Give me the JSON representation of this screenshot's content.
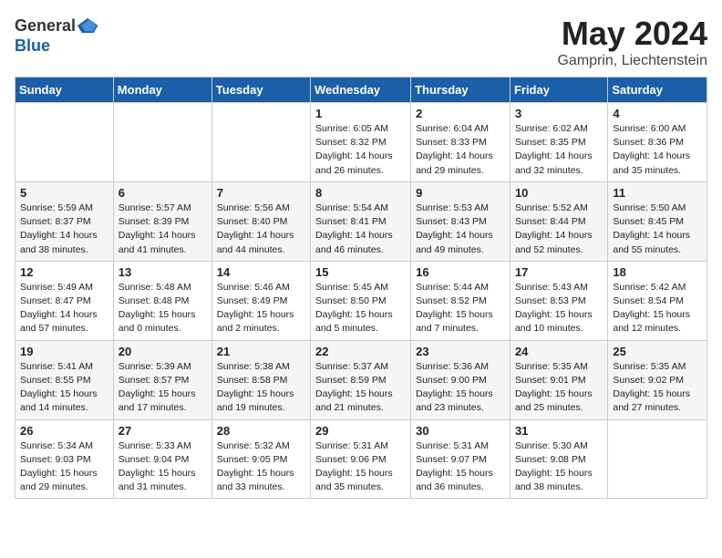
{
  "logo": {
    "general": "General",
    "blue": "Blue"
  },
  "title": "May 2024",
  "location": "Gamprin, Liechtenstein",
  "days_of_week": [
    "Sunday",
    "Monday",
    "Tuesday",
    "Wednesday",
    "Thursday",
    "Friday",
    "Saturday"
  ],
  "weeks": [
    [
      {
        "day": "",
        "info": ""
      },
      {
        "day": "",
        "info": ""
      },
      {
        "day": "",
        "info": ""
      },
      {
        "day": "1",
        "info": "Sunrise: 6:05 AM\nSunset: 8:32 PM\nDaylight: 14 hours\nand 26 minutes."
      },
      {
        "day": "2",
        "info": "Sunrise: 6:04 AM\nSunset: 8:33 PM\nDaylight: 14 hours\nand 29 minutes."
      },
      {
        "day": "3",
        "info": "Sunrise: 6:02 AM\nSunset: 8:35 PM\nDaylight: 14 hours\nand 32 minutes."
      },
      {
        "day": "4",
        "info": "Sunrise: 6:00 AM\nSunset: 8:36 PM\nDaylight: 14 hours\nand 35 minutes."
      }
    ],
    [
      {
        "day": "5",
        "info": "Sunrise: 5:59 AM\nSunset: 8:37 PM\nDaylight: 14 hours\nand 38 minutes."
      },
      {
        "day": "6",
        "info": "Sunrise: 5:57 AM\nSunset: 8:39 PM\nDaylight: 14 hours\nand 41 minutes."
      },
      {
        "day": "7",
        "info": "Sunrise: 5:56 AM\nSunset: 8:40 PM\nDaylight: 14 hours\nand 44 minutes."
      },
      {
        "day": "8",
        "info": "Sunrise: 5:54 AM\nSunset: 8:41 PM\nDaylight: 14 hours\nand 46 minutes."
      },
      {
        "day": "9",
        "info": "Sunrise: 5:53 AM\nSunset: 8:43 PM\nDaylight: 14 hours\nand 49 minutes."
      },
      {
        "day": "10",
        "info": "Sunrise: 5:52 AM\nSunset: 8:44 PM\nDaylight: 14 hours\nand 52 minutes."
      },
      {
        "day": "11",
        "info": "Sunrise: 5:50 AM\nSunset: 8:45 PM\nDaylight: 14 hours\nand 55 minutes."
      }
    ],
    [
      {
        "day": "12",
        "info": "Sunrise: 5:49 AM\nSunset: 8:47 PM\nDaylight: 14 hours\nand 57 minutes."
      },
      {
        "day": "13",
        "info": "Sunrise: 5:48 AM\nSunset: 8:48 PM\nDaylight: 15 hours\nand 0 minutes."
      },
      {
        "day": "14",
        "info": "Sunrise: 5:46 AM\nSunset: 8:49 PM\nDaylight: 15 hours\nand 2 minutes."
      },
      {
        "day": "15",
        "info": "Sunrise: 5:45 AM\nSunset: 8:50 PM\nDaylight: 15 hours\nand 5 minutes."
      },
      {
        "day": "16",
        "info": "Sunrise: 5:44 AM\nSunset: 8:52 PM\nDaylight: 15 hours\nand 7 minutes."
      },
      {
        "day": "17",
        "info": "Sunrise: 5:43 AM\nSunset: 8:53 PM\nDaylight: 15 hours\nand 10 minutes."
      },
      {
        "day": "18",
        "info": "Sunrise: 5:42 AM\nSunset: 8:54 PM\nDaylight: 15 hours\nand 12 minutes."
      }
    ],
    [
      {
        "day": "19",
        "info": "Sunrise: 5:41 AM\nSunset: 8:55 PM\nDaylight: 15 hours\nand 14 minutes."
      },
      {
        "day": "20",
        "info": "Sunrise: 5:39 AM\nSunset: 8:57 PM\nDaylight: 15 hours\nand 17 minutes."
      },
      {
        "day": "21",
        "info": "Sunrise: 5:38 AM\nSunset: 8:58 PM\nDaylight: 15 hours\nand 19 minutes."
      },
      {
        "day": "22",
        "info": "Sunrise: 5:37 AM\nSunset: 8:59 PM\nDaylight: 15 hours\nand 21 minutes."
      },
      {
        "day": "23",
        "info": "Sunrise: 5:36 AM\nSunset: 9:00 PM\nDaylight: 15 hours\nand 23 minutes."
      },
      {
        "day": "24",
        "info": "Sunrise: 5:35 AM\nSunset: 9:01 PM\nDaylight: 15 hours\nand 25 minutes."
      },
      {
        "day": "25",
        "info": "Sunrise: 5:35 AM\nSunset: 9:02 PM\nDaylight: 15 hours\nand 27 minutes."
      }
    ],
    [
      {
        "day": "26",
        "info": "Sunrise: 5:34 AM\nSunset: 9:03 PM\nDaylight: 15 hours\nand 29 minutes."
      },
      {
        "day": "27",
        "info": "Sunrise: 5:33 AM\nSunset: 9:04 PM\nDaylight: 15 hours\nand 31 minutes."
      },
      {
        "day": "28",
        "info": "Sunrise: 5:32 AM\nSunset: 9:05 PM\nDaylight: 15 hours\nand 33 minutes."
      },
      {
        "day": "29",
        "info": "Sunrise: 5:31 AM\nSunset: 9:06 PM\nDaylight: 15 hours\nand 35 minutes."
      },
      {
        "day": "30",
        "info": "Sunrise: 5:31 AM\nSunset: 9:07 PM\nDaylight: 15 hours\nand 36 minutes."
      },
      {
        "day": "31",
        "info": "Sunrise: 5:30 AM\nSunset: 9:08 PM\nDaylight: 15 hours\nand 38 minutes."
      },
      {
        "day": "",
        "info": ""
      }
    ]
  ]
}
